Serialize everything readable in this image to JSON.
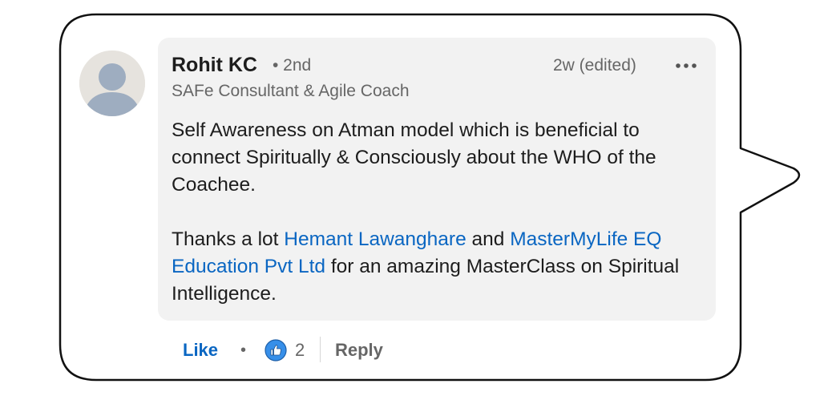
{
  "comment": {
    "author": {
      "name": "Rohit KC",
      "degree": "• 2nd",
      "headline": "SAFe Consultant & Agile Coach",
      "avatar_icon": "default-person-avatar"
    },
    "timestamp": "2w (edited)",
    "more_icon": "more-horizontal-icon",
    "paragraph1": "Self Awareness on Atman model which is beneficial to connect Spiritually & Consciously about the WHO of the Coachee.",
    "paragraph2": {
      "prefix": "Thanks a lot ",
      "mention1": "Hemant Lawanghare",
      "middle": " and ",
      "mention2": "MasterMyLife EQ Education Pvt Ltd",
      "suffix": " for an amazing MasterClass on Spiritual Intelligence."
    }
  },
  "actions": {
    "like_label": "Like",
    "separator": "•",
    "reaction_icon": "like-thumbs-up-icon",
    "reaction_count": "2",
    "reply_label": "Reply"
  },
  "colors": {
    "link": "#0a66c2",
    "secondary_text": "#666666",
    "comment_bg": "#f2f2f2",
    "avatar_bg": "#e6e3de",
    "avatar_figure": "#9eadc0"
  }
}
